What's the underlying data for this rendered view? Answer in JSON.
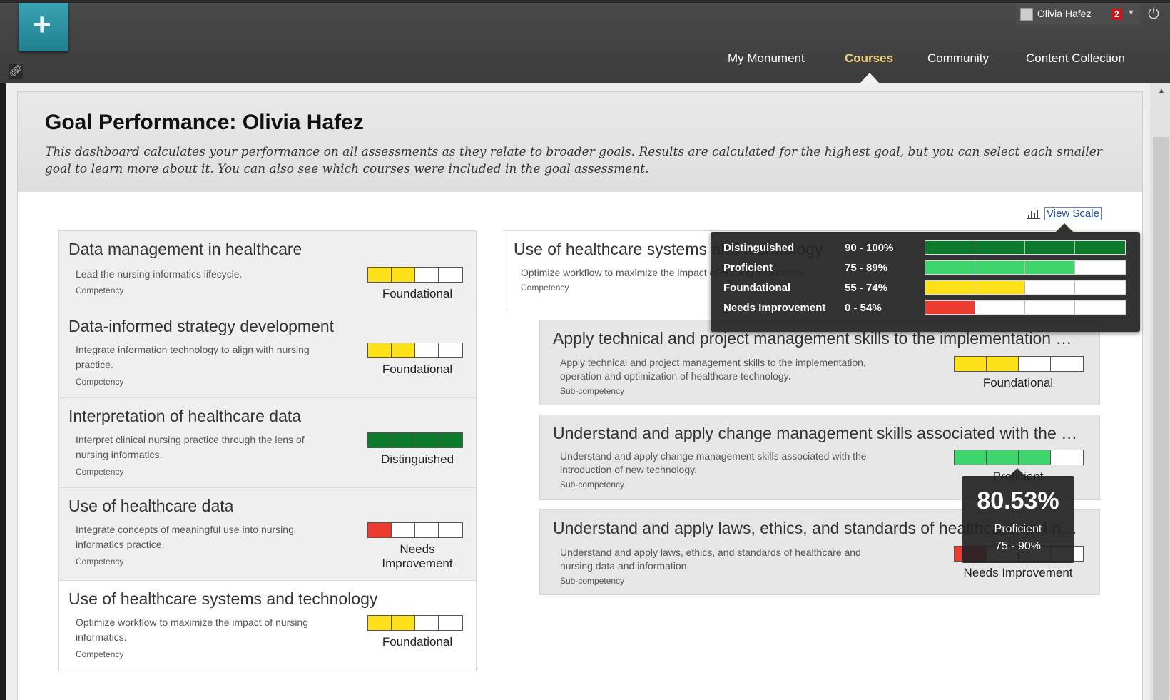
{
  "header": {
    "logo_icon": "plus-icon",
    "link_icon": "link-icon",
    "user_name": "Olivia Hafez",
    "notification_count": "2",
    "power_icon": "power-icon",
    "nav": [
      {
        "label": "My Monument",
        "active": false
      },
      {
        "label": "Courses",
        "active": true
      },
      {
        "label": "Community",
        "active": false
      },
      {
        "label": "Content Collection",
        "active": false
      }
    ]
  },
  "page": {
    "title": "Goal Performance: Olivia Hafez",
    "intro": "This dashboard calculates your performance on all assessments as they relate to broader goals. Results are calculated for the highest goal, but you can select each smaller goal to learn more about it. You can also see which courses were included in the goal assessment.",
    "view_scale": "View Scale"
  },
  "colors": {
    "distinguished": "#0b7a2a",
    "proficient": "#3ed66c",
    "foundational": "#ffe11a",
    "needs_improvement": "#ee3b2f",
    "empty": "#ffffff"
  },
  "competencies": [
    {
      "title": "Data management in healthcare",
      "desc": [
        "Lead the nursing informatics lifecycle."
      ],
      "type": "Competency",
      "level": [
        "Foundational"
      ],
      "filled": 2,
      "color": "#ffe11a"
    },
    {
      "title": "Data-informed strategy development",
      "desc": [
        "Integrate information technology to align with nursing",
        "practice."
      ],
      "type": "Competency",
      "level": [
        "Foundational"
      ],
      "filled": 2,
      "color": "#ffe11a"
    },
    {
      "title": "Interpretation of healthcare data",
      "desc": [
        "Interpret clinical nursing practice through the lens of",
        "nursing informatics."
      ],
      "type": "Competency",
      "level": [
        "Distinguished"
      ],
      "filled": 4,
      "color": "#0b7a2a"
    },
    {
      "title": "Use of healthcare data",
      "desc": [
        "Integrate concepts of meaningful use into nursing",
        "informatics practice."
      ],
      "type": "Competency",
      "level": [
        "Needs",
        "Improvement"
      ],
      "filled": 1,
      "color": "#ee3b2f"
    },
    {
      "title": "Use of healthcare systems and technology",
      "desc": [
        "Optimize workflow to maximize the impact of nursing",
        "informatics."
      ],
      "type": "Competency",
      "level": [
        "Foundational"
      ],
      "filled": 2,
      "color": "#ffe11a"
    }
  ],
  "selected": {
    "title": "Use of healthcare systems and technology",
    "desc": "Optimize workflow to maximize the impact of nursing informatics.",
    "type": "Competency"
  },
  "subcompetencies": [
    {
      "title": "Apply technical and project management skills to the implementation and optimization of healthcare technology",
      "desc": [
        "Apply technical and project management skills to the implementation,",
        "operation and optimization of healthcare technology."
      ],
      "type": "Sub-competency",
      "level": "Foundational",
      "filled": 2,
      "color": "#ffe11a"
    },
    {
      "title": "Understand and apply change management skills associated with the introduction of new technology",
      "desc": [
        "Understand and apply change management skills associated with the",
        "introduction of new technology."
      ],
      "type": "Sub-competency",
      "level": "Proficient",
      "filled": 3,
      "color": "#3ed66c"
    },
    {
      "title": "Understand and apply laws, ethics, and standards of healthcare and nursing data and information",
      "desc": [
        "Understand and apply laws, ethics, and standards of healthcare and",
        "nursing data and information."
      ],
      "type": "Sub-competency",
      "level": "Needs Improvement",
      "filled": 1,
      "color": "#ee3b2f"
    }
  ],
  "scale": [
    {
      "name": "Distinguished",
      "range": "90 - 100%",
      "filled": 4,
      "color": "#0b7a2a"
    },
    {
      "name": "Proficient",
      "range": "75 - 89%",
      "filled": 3,
      "color": "#3ed66c"
    },
    {
      "name": "Foundational",
      "range": "55 - 74%",
      "filled": 2,
      "color": "#ffe11a"
    },
    {
      "name": "Needs Improvement",
      "range": "0 - 54%",
      "filled": 1,
      "color": "#ee3b2f"
    }
  ],
  "score_tooltip": {
    "score": "80.53%",
    "level": "Proficient",
    "range": "75 - 90%"
  }
}
